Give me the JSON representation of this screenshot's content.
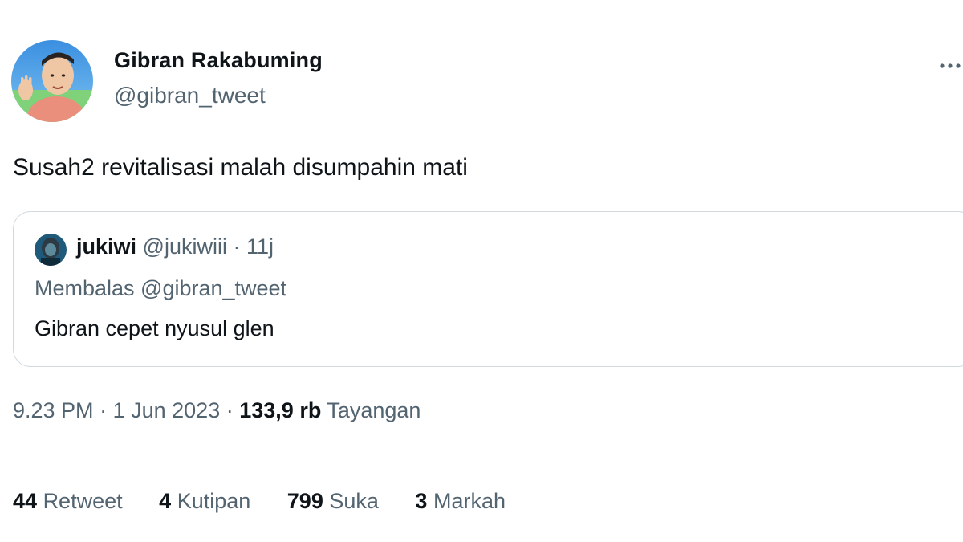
{
  "author": {
    "name": "Gibran Rakabuming",
    "handle": "@gibran_tweet",
    "avatar_icon": "profile-photo"
  },
  "tweet": {
    "text": "Susah2 revitalisasi malah disumpahin mati"
  },
  "quoted": {
    "name": "jukiwi",
    "handle": "@jukiwiii",
    "dot": "·",
    "time": "11j",
    "reply_to": "Membalas @gibran_tweet",
    "text": "Gibran cepet nyusul glen"
  },
  "meta": {
    "time": "9.23 PM",
    "sep1": "·",
    "date": "1 Jun 2023",
    "sep2": "·",
    "views_count": "133,9 rb",
    "views_label": "Tayangan"
  },
  "stats": [
    {
      "count": "44",
      "label": "Retweet"
    },
    {
      "count": "4",
      "label": "Kutipan"
    },
    {
      "count": "799",
      "label": "Suka"
    },
    {
      "count": "3",
      "label": "Markah"
    }
  ],
  "colors": {
    "text_primary": "#0f1419",
    "text_secondary": "#536471",
    "border": "#cfd9de"
  },
  "icons": {
    "more": "more-horizontal-icon"
  }
}
